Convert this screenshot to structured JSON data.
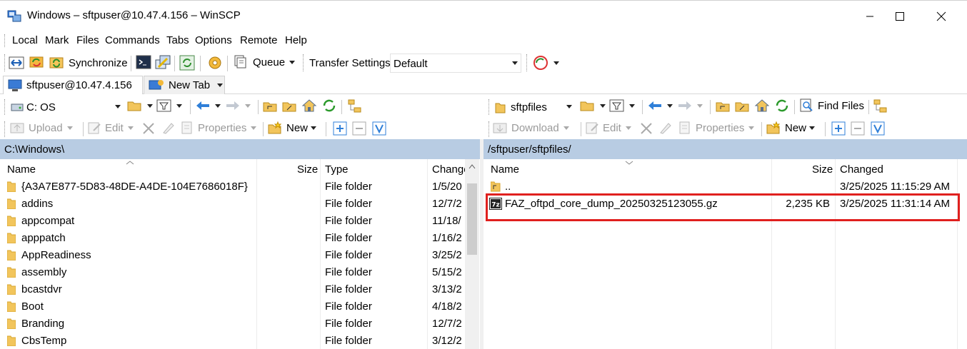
{
  "window": {
    "title": "Windows – sftpuser@10.47.4.156 – WinSCP"
  },
  "menu": [
    "Local",
    "Mark",
    "Files",
    "Commands",
    "Tabs",
    "Options",
    "Remote",
    "Help"
  ],
  "toolbar": {
    "synchronize": "Synchronize",
    "queue": "Queue",
    "transfer_settings_label": "Transfer Settings",
    "transfer_settings_value": "Default"
  },
  "tabs": [
    {
      "label": "sftpuser@10.47.4.156"
    },
    {
      "label": "New Tab"
    }
  ],
  "local": {
    "drive": "C: OS",
    "actions": {
      "upload": "Upload",
      "edit": "Edit",
      "properties": "Properties",
      "new": "New"
    },
    "path": "C:\\Windows\\",
    "columns": {
      "name": "Name",
      "size": "Size",
      "type": "Type",
      "changed": "Change"
    },
    "rows": [
      {
        "name": "{A3A7E877-5D83-48DE-A4DE-104E7686018F}",
        "type": "File folder",
        "changed": "1/5/20"
      },
      {
        "name": "addins",
        "type": "File folder",
        "changed": "12/7/2"
      },
      {
        "name": "appcompat",
        "type": "File folder",
        "changed": "11/18/"
      },
      {
        "name": "apppatch",
        "type": "File folder",
        "changed": "1/16/2"
      },
      {
        "name": "AppReadiness",
        "type": "File folder",
        "changed": "3/25/2"
      },
      {
        "name": "assembly",
        "type": "File folder",
        "changed": "5/15/2"
      },
      {
        "name": "bcastdvr",
        "type": "File folder",
        "changed": "3/13/2"
      },
      {
        "name": "Boot",
        "type": "File folder",
        "changed": "4/18/2"
      },
      {
        "name": "Branding",
        "type": "File folder",
        "changed": "12/7/2"
      },
      {
        "name": "CbsTemp",
        "type": "File folder",
        "changed": "3/12/2"
      }
    ]
  },
  "remote": {
    "folder": "sftpfiles",
    "find_files": "Find Files",
    "actions": {
      "download": "Download",
      "edit": "Edit",
      "properties": "Properties",
      "new": "New"
    },
    "path": "/sftpuser/sftpfiles/",
    "columns": {
      "name": "Name",
      "size": "Size",
      "changed": "Changed"
    },
    "rows": [
      {
        "name": "..",
        "size": "",
        "changed": "3/25/2025 11:15:29 AM"
      },
      {
        "name": "FAZ_oftpd_core_dump_20250325123055.gz",
        "size": "2,235 KB",
        "changed": "3/25/2025 11:31:14 AM"
      }
    ]
  },
  "colors": {
    "path_bar": "#b8cce3",
    "highlight": "#e0201e",
    "folder": "#f2c55c"
  }
}
